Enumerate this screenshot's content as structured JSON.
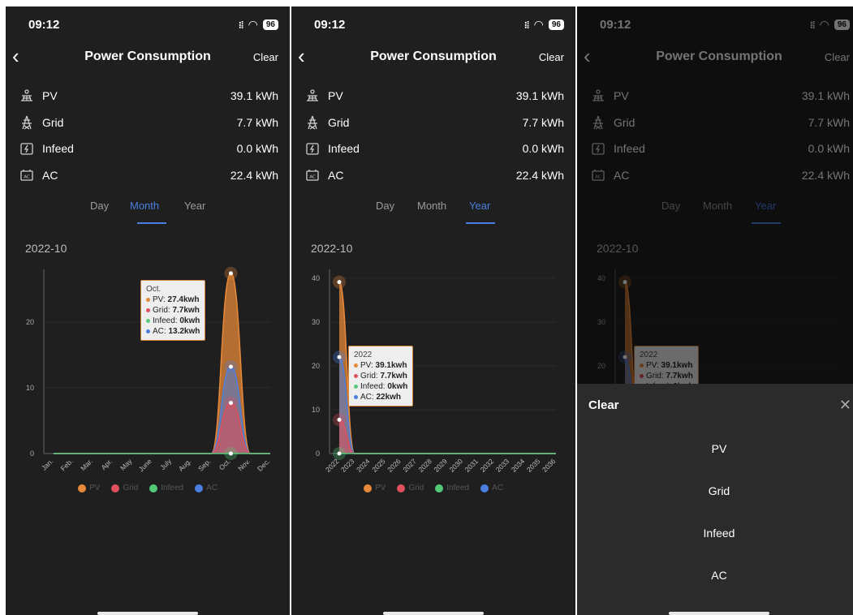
{
  "status": {
    "time": "09:12",
    "signal": "⁝⁞",
    "wifi": "◠",
    "battery": "96"
  },
  "header": {
    "title": "Power Consumption",
    "back": "‹",
    "clear_label": "Clear"
  },
  "metrics": [
    {
      "name": "PV",
      "value": "39.1 kWh",
      "icon": "solar-panel-icon"
    },
    {
      "name": "Grid",
      "value": "7.7 kWh",
      "icon": "power-tower-icon"
    },
    {
      "name": "Infeed",
      "value": "0.0 kWh",
      "icon": "battery-icon"
    },
    {
      "name": "AC",
      "value": "22.4 kWh",
      "icon": "ac-meter-icon"
    }
  ],
  "tabs": [
    "Day",
    "Month",
    "Year"
  ],
  "date": "2022-10",
  "legend": [
    "PV",
    "Grid",
    "Infeed",
    "AC"
  ],
  "colors": {
    "PV": "#e8893a",
    "Grid": "#e0505c",
    "Infeed": "#55c97a",
    "AC": "#4a7fe0"
  },
  "tooltip_month": {
    "title": "Oct.",
    "lines": [
      {
        "label": "PV: ",
        "value": "27.4kwh"
      },
      {
        "label": "Grid: ",
        "value": "7.7kwh"
      },
      {
        "label": "Infeed: ",
        "value": "0kwh"
      },
      {
        "label": "AC: ",
        "value": "13.2kwh"
      }
    ]
  },
  "tooltip_year": {
    "title": "2022",
    "lines": [
      {
        "label": "PV: ",
        "value": "39.1kwh"
      },
      {
        "label": "Grid: ",
        "value": "7.7kwh"
      },
      {
        "label": "Infeed: ",
        "value": "0kwh"
      },
      {
        "label": "AC: ",
        "value": "22kwh"
      }
    ]
  },
  "sheet": {
    "title": "Clear",
    "close": "✕",
    "options": [
      "PV",
      "Grid",
      "Infeed",
      "AC"
    ]
  },
  "chart_data": [
    {
      "type": "area",
      "title": "",
      "categories": [
        "Jan.",
        "Feb.",
        "Mar.",
        "Apr.",
        "May",
        "June",
        "July",
        "Aug.",
        "Sep.",
        "Oct.",
        "Nov.",
        "Dec."
      ],
      "yticks": [
        0,
        10,
        20
      ],
      "ylim": [
        0,
        28
      ],
      "series": [
        {
          "name": "PV",
          "values": [
            0,
            0,
            0,
            0,
            0,
            0,
            0,
            0,
            0,
            27.4,
            0,
            0
          ]
        },
        {
          "name": "Grid",
          "values": [
            0,
            0,
            0,
            0,
            0,
            0,
            0,
            0,
            0,
            7.7,
            0,
            0
          ]
        },
        {
          "name": "Infeed",
          "values": [
            0,
            0,
            0,
            0,
            0,
            0,
            0,
            0,
            0,
            0,
            0,
            0
          ]
        },
        {
          "name": "AC",
          "values": [
            0,
            0,
            0,
            0,
            0,
            0,
            0,
            0,
            0,
            13.2,
            0,
            0
          ]
        }
      ],
      "legend": "bottom"
    },
    {
      "type": "area",
      "title": "",
      "categories": [
        "2022",
        "2023",
        "2024",
        "2025",
        "2026",
        "2027",
        "2028",
        "2029",
        "2030",
        "2031",
        "2032",
        "2033",
        "2034",
        "2035",
        "2036"
      ],
      "yticks": [
        0,
        10,
        20,
        30,
        40
      ],
      "ylim": [
        0,
        42
      ],
      "series": [
        {
          "name": "PV",
          "values": [
            39.1,
            0,
            0,
            0,
            0,
            0,
            0,
            0,
            0,
            0,
            0,
            0,
            0,
            0,
            0
          ]
        },
        {
          "name": "Grid",
          "values": [
            7.7,
            0,
            0,
            0,
            0,
            0,
            0,
            0,
            0,
            0,
            0,
            0,
            0,
            0,
            0
          ]
        },
        {
          "name": "Infeed",
          "values": [
            0,
            0,
            0,
            0,
            0,
            0,
            0,
            0,
            0,
            0,
            0,
            0,
            0,
            0,
            0
          ]
        },
        {
          "name": "AC",
          "values": [
            22,
            0,
            0,
            0,
            0,
            0,
            0,
            0,
            0,
            0,
            0,
            0,
            0,
            0,
            0
          ]
        }
      ],
      "legend": "bottom"
    }
  ]
}
